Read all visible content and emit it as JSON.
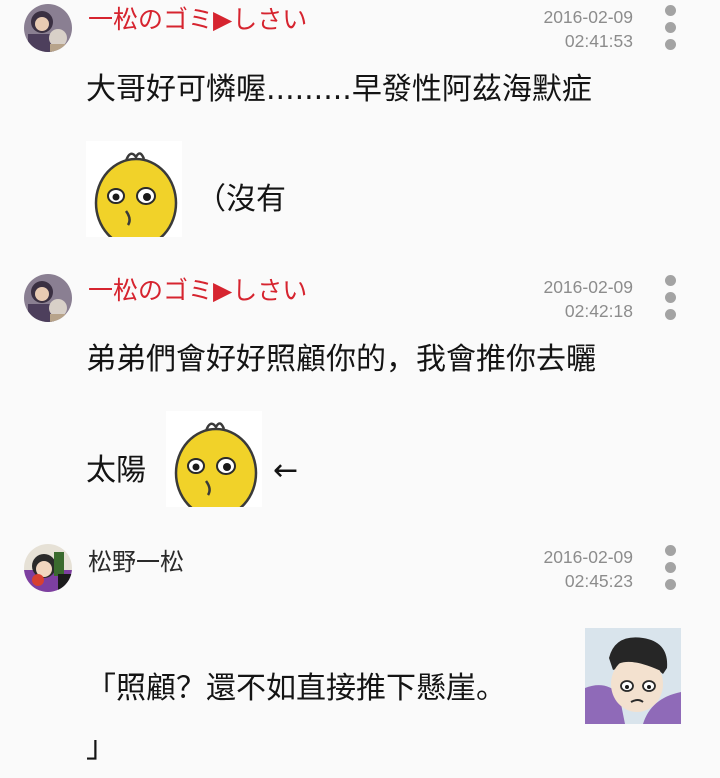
{
  "comments": [
    {
      "author": "一松のゴミ▶しさい",
      "date": "2016-02-09",
      "time": "02:41:53",
      "line1": "大哥好可憐喔.........早發性阿茲海默症",
      "line2": "（沒有"
    },
    {
      "author": "一松のゴミ▶しさい",
      "date": "2016-02-09",
      "time": "02:42:18",
      "line1": "弟弟們會好好照顧你的，我會推你去曬",
      "line2": "太陽",
      "arrow": "←"
    },
    {
      "author": "松野一松",
      "date": "2016-02-09",
      "time": "02:45:23",
      "line1": "「照顧？還不如直接推下懸崖。",
      "line2": "」"
    }
  ],
  "colors": {
    "author_red": "#d6242f",
    "background": "#fafafa",
    "timestamp": "#8c8c8c"
  },
  "icons": {
    "more": "vertical-dots-more-icon",
    "sticker": "yellow-bird-sticker",
    "avatar": "user-avatar"
  }
}
